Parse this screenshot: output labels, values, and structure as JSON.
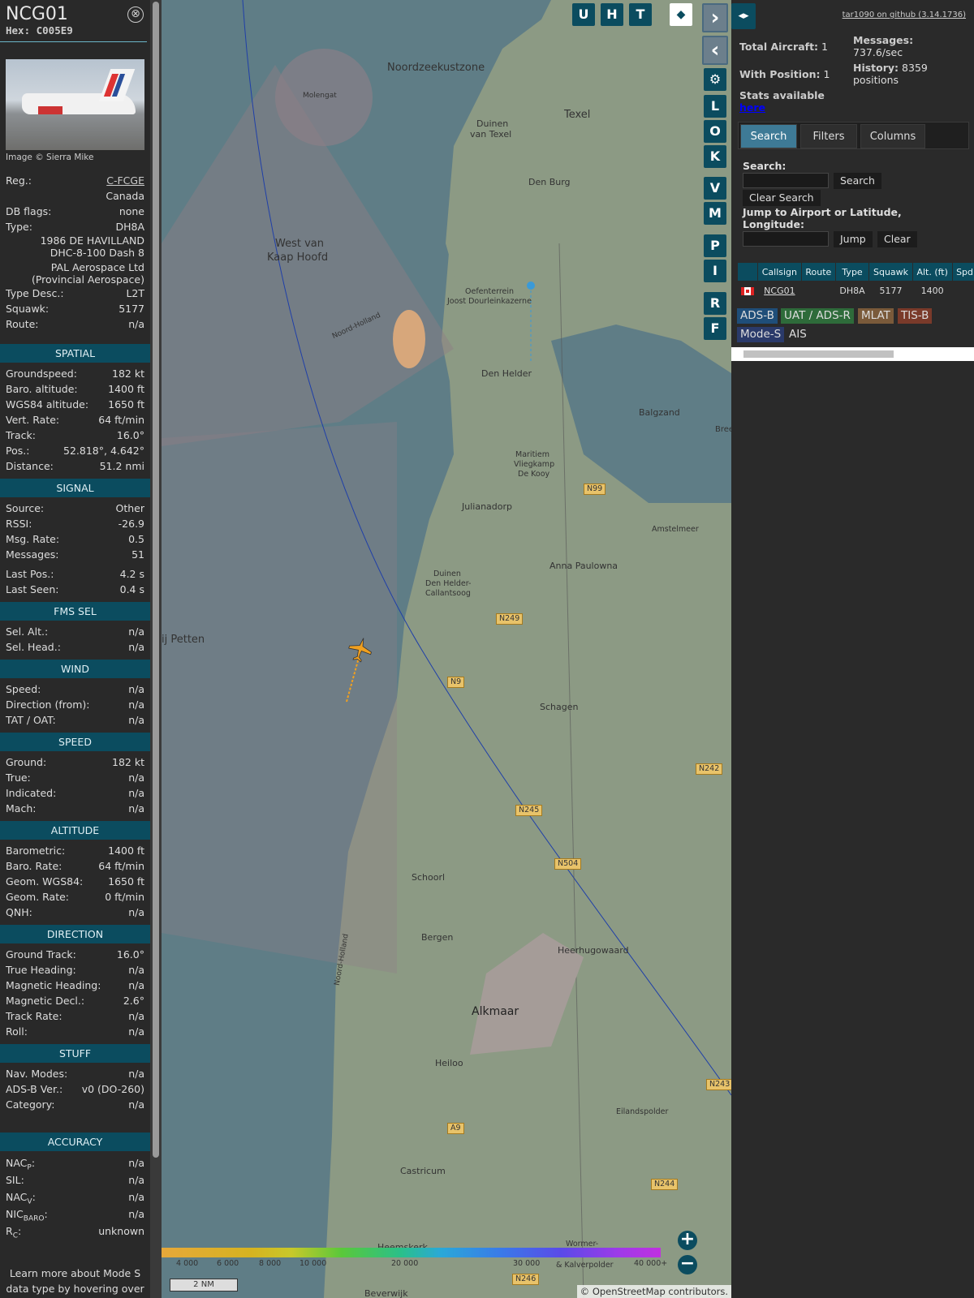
{
  "sidebar": {
    "callsign": "NCG01",
    "hex": "Hex: C005E9",
    "close": "⊗",
    "photo_credit": "Image © Sierra Mike",
    "reg_label": "Reg.:",
    "reg": "C-FCGE",
    "country": "Canada",
    "dbflags_label": "DB flags:",
    "dbflags": "none",
    "type_label": "Type:",
    "type": "DH8A",
    "model1": "1986 DE HAVILLAND",
    "model2": "DHC-8-100 Dash 8",
    "owner1": "PAL Aerospace Ltd",
    "owner2": "(Provincial Aerospace)",
    "typedesc_label": "Type Desc.:",
    "typedesc": "L2T",
    "squawk_label": "Squawk:",
    "squawk": "5177",
    "route_label": "Route:",
    "route": "n/a",
    "sections": {
      "spatial": {
        "title": "SPATIAL",
        "rows": [
          [
            "Groundspeed:",
            "182 kt"
          ],
          [
            "Baro. altitude:",
            "1400 ft"
          ],
          [
            "WGS84 altitude:",
            "1650 ft"
          ],
          [
            "Vert. Rate:",
            "64 ft/min"
          ],
          [
            "Track:",
            "16.0°"
          ],
          [
            "Pos.:",
            "52.818°, 4.642°"
          ],
          [
            "Distance:",
            "51.2 nmi"
          ]
        ]
      },
      "signal": {
        "title": "SIGNAL",
        "rows": [
          [
            "Source:",
            "Other"
          ],
          [
            "RSSI:",
            "-26.9"
          ],
          [
            "Msg. Rate:",
            "0.5"
          ],
          [
            "Messages:",
            "51"
          ],
          [
            "Last Pos.:",
            "4.2 s"
          ],
          [
            "Last Seen:",
            "0.4 s"
          ]
        ]
      },
      "fms": {
        "title": "FMS SEL",
        "rows": [
          [
            "Sel. Alt.:",
            "n/a"
          ],
          [
            "Sel. Head.:",
            "n/a"
          ]
        ]
      },
      "wind": {
        "title": "WIND",
        "rows": [
          [
            "Speed:",
            "n/a"
          ],
          [
            "Direction (from):",
            "n/a"
          ],
          [
            "TAT / OAT:",
            "n/a"
          ]
        ]
      },
      "speed": {
        "title": "SPEED",
        "rows": [
          [
            "Ground:",
            "182 kt"
          ],
          [
            "True:",
            "n/a"
          ],
          [
            "Indicated:",
            "n/a"
          ],
          [
            "Mach:",
            "n/a"
          ]
        ]
      },
      "altitude": {
        "title": "ALTITUDE",
        "rows": [
          [
            "Barometric:",
            "1400 ft"
          ],
          [
            "Baro. Rate:",
            "64 ft/min"
          ],
          [
            "Geom. WGS84:",
            "1650 ft"
          ],
          [
            "Geom. Rate:",
            "0 ft/min"
          ],
          [
            "QNH:",
            "n/a"
          ]
        ]
      },
      "direction": {
        "title": "DIRECTION",
        "rows": [
          [
            "Ground Track:",
            "16.0°"
          ],
          [
            "True Heading:",
            "n/a"
          ],
          [
            "Magnetic Heading:",
            "n/a"
          ],
          [
            "Magnetic Decl.:",
            "2.6°"
          ],
          [
            "Track Rate:",
            "n/a"
          ],
          [
            "Roll:",
            "n/a"
          ]
        ]
      },
      "stuff": {
        "title": "STUFF",
        "rows": [
          [
            "Nav. Modes:",
            "n/a"
          ],
          [
            "ADS-B Ver.:",
            "v0 (DO-260)"
          ],
          [
            "Category:",
            "n/a"
          ]
        ]
      },
      "accuracy": {
        "title": "ACCURACY",
        "rows": [
          [
            "NAC",
            "P",
            ":",
            "n/a"
          ],
          [
            "SIL:",
            "",
            "",
            "n/a"
          ],
          [
            "NAC",
            "V",
            ":",
            "n/a"
          ],
          [
            "NIC",
            "BARO",
            ":",
            "n/a"
          ],
          [
            "R",
            "C",
            ":",
            "unknown"
          ]
        ]
      }
    },
    "footer1": "Learn more about Mode S",
    "footer2": "data type by hovering over"
  },
  "map": {
    "buttons": {
      "u": "U",
      "h": "H",
      "t": "T",
      "l": "L",
      "o": "O",
      "k": "K",
      "v": "V",
      "m": "M",
      "p": "P",
      "i": "I",
      "r": "R",
      "f": "F",
      "next": "›",
      "prev": "‹",
      "expand": "◂▸",
      "layers": "layers",
      "settings": "⚙"
    },
    "labels": {
      "noordzee": "Noordzeekustzone",
      "texel": "Texel",
      "duinen": "Duinen",
      "vantexel": "van Texel",
      "denburg": "Den Burg",
      "molengat": "Molengat",
      "westvan": "West van",
      "kaaphoofd": "Kaap Hoofd",
      "oefenterrein": "Oefenterrein",
      "joost": "Joost Dourleinkazerne",
      "noordholland": "Noord-Holland",
      "denhelder": "Den Helder",
      "balgzand": "Balgzand",
      "bree": "Bree",
      "maritiem": "Maritiem",
      "vliegkamp": "Vliegkamp",
      "dekooy": "De Kooy",
      "julianadorp": "Julianadorp",
      "amstelmeer": "Amstelmeer",
      "annapaulowna": "Anna Paulowna",
      "duinen2": "Duinen",
      "denhelder2": "Den Helder-",
      "callantsoog": "Callantsoog",
      "petten": "ij Petten",
      "schagen": "Schagen",
      "schoorl": "Schoorl",
      "bergen": "Bergen",
      "heerhugowaard": "Heerhugowaard",
      "alkmaar": "Alkmaar",
      "heiloo": "Heiloo",
      "eilandspolder": "Eilandspolder",
      "castricum": "Castricum",
      "heemskerk": "Heemskerk",
      "wormer": "Wormer-",
      "kalverpolder": "& Kalverpolder",
      "beverwijk": "Beverwijk",
      "noordholland2": "Noord-Holland"
    },
    "roads": {
      "n99": "N99",
      "n249": "N249",
      "n9": "N9",
      "n242": "N242",
      "n245": "N245",
      "n504": "N504",
      "n243": "N243",
      "a9": "A9",
      "n244": "N244",
      "n246": "N246"
    },
    "legend": [
      "4 000",
      "6 000",
      "8 000",
      "10 000",
      "20 000",
      "30 000",
      "40 000+"
    ],
    "scale": "2 NM",
    "zoom_in": "+",
    "zoom_out": "−",
    "attribution": "© OpenStreetMap contributors."
  },
  "panel": {
    "github": "tar1090 on github (3.14.1736)",
    "total_label": "Total Aircraft:",
    "total": "1",
    "withpos_label": "With Position:",
    "withpos": "1",
    "messages_label": "Messages:",
    "messages": "737.6/sec",
    "history_label": "History:",
    "history": "8359",
    "history_unit": "positions",
    "stats_label": "Stats available",
    "stats_link": "here",
    "tabs": [
      "Search",
      "Filters",
      "Columns"
    ],
    "search_label": "Search:",
    "search_btn": "Search",
    "clear_search": "Clear Search",
    "jump_label": "Jump to Airport or Latitude, Longitude:",
    "jump_btn": "Jump",
    "clear_btn": "Clear",
    "columns": [
      "",
      "Callsign",
      "Route",
      "Type",
      "Squawk",
      "Alt. (ft)",
      "Spd."
    ],
    "rows": [
      {
        "callsign": "NCG01",
        "route": "",
        "type": "DH8A",
        "squawk": "5177",
        "alt": "1400"
      }
    ],
    "sources": [
      "ADS-B",
      "UAT / ADS-R",
      "MLAT",
      "TIS-B",
      "Mode-S",
      "AIS"
    ],
    "colors": {
      "adsb": "#1f4e79",
      "uat": "#2e6b3a",
      "mlat": "#7a5a3a",
      "tisb": "#7a3a2a",
      "modes": "#2a3a6a"
    }
  }
}
